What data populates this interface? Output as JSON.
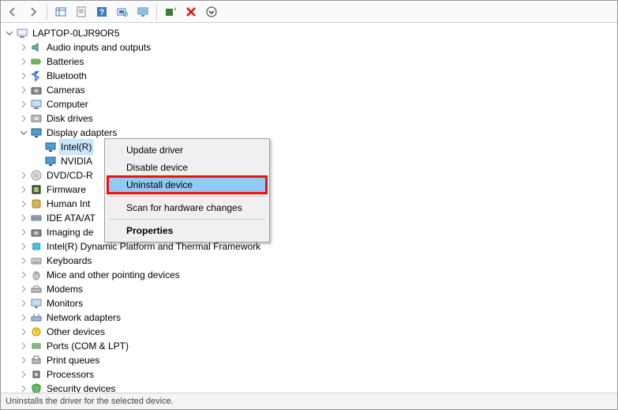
{
  "toolbar": {
    "back": "Back",
    "forward": "Forward",
    "show_hidden": "Show hidden devices",
    "properties": "Properties",
    "help": "Help",
    "scan": "Scan for hardware changes",
    "update": "Update device",
    "add_legacy": "Add legacy hardware",
    "uninstall": "Uninstall device",
    "view_menu": "View"
  },
  "root": {
    "name": "LAPTOP-0LJR9OR5"
  },
  "categories": [
    {
      "key": "audio",
      "label": "Audio inputs and outputs",
      "icon": "speaker-icon",
      "expanded": false
    },
    {
      "key": "batteries",
      "label": "Batteries",
      "icon": "battery-icon",
      "expanded": false
    },
    {
      "key": "bluetooth",
      "label": "Bluetooth",
      "icon": "bluetooth-icon",
      "expanded": false
    },
    {
      "key": "cameras",
      "label": "Cameras",
      "icon": "camera-icon",
      "expanded": false
    },
    {
      "key": "computer",
      "label": "Computer",
      "icon": "computer-icon",
      "expanded": false
    },
    {
      "key": "diskdrives",
      "label": "Disk drives",
      "icon": "disk-icon",
      "expanded": false
    },
    {
      "key": "display",
      "label": "Display adapters",
      "icon": "display-icon",
      "expanded": true,
      "children": [
        {
          "key": "intel",
          "label": "Intel(R)",
          "icon": "display-icon",
          "selected": true
        },
        {
          "key": "nvidia",
          "label": "NVIDIA",
          "icon": "display-icon",
          "selected": false
        }
      ]
    },
    {
      "key": "dvd",
      "label": "DVD/CD-R",
      "icon": "dvd-icon",
      "expanded": false
    },
    {
      "key": "firmware",
      "label": "Firmware",
      "icon": "firmware-icon",
      "expanded": false
    },
    {
      "key": "hid",
      "label": "Human Int",
      "icon": "hid-icon",
      "expanded": false
    },
    {
      "key": "ide",
      "label": "IDE ATA/AT",
      "icon": "ide-icon",
      "expanded": false
    },
    {
      "key": "imaging",
      "label": "Imaging de",
      "icon": "camera-icon",
      "expanded": false
    },
    {
      "key": "dptf",
      "label": "Intel(R) Dynamic Platform and Thermal Framework",
      "icon": "chip-icon",
      "expanded": false
    },
    {
      "key": "keyboards",
      "label": "Keyboards",
      "icon": "keyboard-icon",
      "expanded": false
    },
    {
      "key": "mice",
      "label": "Mice and other pointing devices",
      "icon": "mouse-icon",
      "expanded": false
    },
    {
      "key": "modems",
      "label": "Modems",
      "icon": "modem-icon",
      "expanded": false
    },
    {
      "key": "monitors",
      "label": "Monitors",
      "icon": "monitor-icon",
      "expanded": false
    },
    {
      "key": "network",
      "label": "Network adapters",
      "icon": "network-icon",
      "expanded": false
    },
    {
      "key": "other",
      "label": "Other devices",
      "icon": "other-icon",
      "expanded": false
    },
    {
      "key": "ports",
      "label": "Ports (COM & LPT)",
      "icon": "port-icon",
      "expanded": false
    },
    {
      "key": "printq",
      "label": "Print queues",
      "icon": "printer-icon",
      "expanded": false
    },
    {
      "key": "processors",
      "label": "Processors",
      "icon": "cpu-icon",
      "expanded": false
    },
    {
      "key": "security",
      "label": "Security devices",
      "icon": "security-icon",
      "expanded": false
    }
  ],
  "context_menu": {
    "items": [
      {
        "label": "Update driver",
        "hover": false,
        "highlight": false
      },
      {
        "label": "Disable device",
        "hover": false,
        "highlight": false
      },
      {
        "label": "Uninstall device",
        "hover": true,
        "highlight": true
      },
      {
        "sep": true
      },
      {
        "label": "Scan for hardware changes",
        "hover": false,
        "highlight": false
      },
      {
        "sep": true
      },
      {
        "label": "Properties",
        "hover": false,
        "highlight": false,
        "bold": true
      }
    ]
  },
  "statusbar": {
    "text": "Uninstalls the driver for the selected device."
  }
}
